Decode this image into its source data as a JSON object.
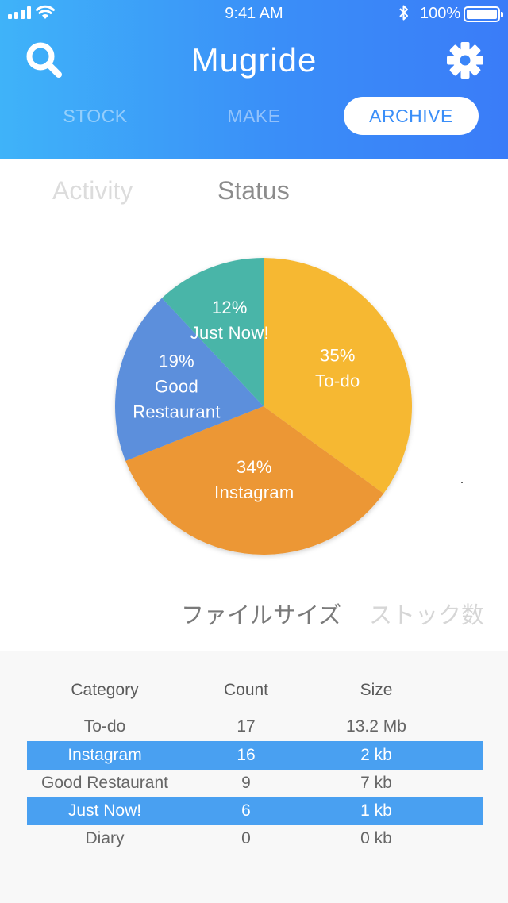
{
  "status_bar": {
    "time": "9:41 AM",
    "battery": "100%",
    "icons": [
      "signal-icon",
      "wifi-icon",
      "bluetooth-icon",
      "battery-icon"
    ]
  },
  "header": {
    "title": "Mugride",
    "search_icon": "search-icon",
    "settings_icon": "gear-icon"
  },
  "top_tabs": [
    {
      "label": "STOCK",
      "active": false
    },
    {
      "label": "MAKE",
      "active": false
    },
    {
      "label": "ARCHIVE",
      "active": true
    }
  ],
  "sub_tabs": [
    {
      "label": "Activity",
      "active": false
    },
    {
      "label": "Status",
      "active": true
    }
  ],
  "chart_data": {
    "type": "pie",
    "title": "",
    "slices": [
      {
        "label": "To-do",
        "percent": 35,
        "color": "#f6b833"
      },
      {
        "label": "Instagram",
        "percent": 34,
        "color": "#ec9734"
      },
      {
        "label": "Good Restaurant",
        "percent": 19,
        "color": "#5b8fdc"
      },
      {
        "label": "Just Now!",
        "percent": 12,
        "color": "#4ab5a8"
      }
    ]
  },
  "metric_tabs": [
    {
      "label": "ファイルサイズ",
      "active": true
    },
    {
      "label": "ストック数",
      "active": false
    }
  ],
  "table": {
    "headers": [
      "Category",
      "Count",
      "Size"
    ],
    "rows": [
      {
        "category": "To-do",
        "count": "17",
        "size": "13.2 Mb",
        "highlighted": false
      },
      {
        "category": "Instagram",
        "count": "16",
        "size": "2 kb",
        "highlighted": true
      },
      {
        "category": "Good Restaurant",
        "count": "9",
        "size": "7 kb",
        "highlighted": false
      },
      {
        "category": "Just Now!",
        "count": "6",
        "size": "1 kb",
        "highlighted": true
      },
      {
        "category": "Diary",
        "count": "0",
        "size": "0 kb",
        "highlighted": false
      }
    ]
  },
  "colors": {
    "header_gradient_start": "#3fb3f9",
    "header_gradient_end": "#3a7cf8",
    "row_highlight": "#49a0f1"
  }
}
